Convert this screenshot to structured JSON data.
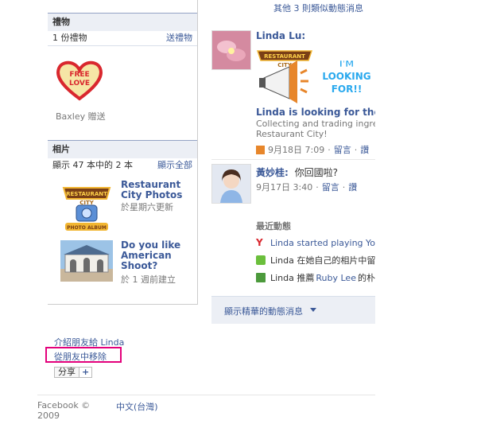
{
  "right_top": {
    "similar_news": "其他 3 則類似動態消息"
  },
  "gifts": {
    "header": "禮物",
    "count": "1 份禮物",
    "send": "送禮物",
    "heart_text": "FREE LOVE",
    "from": "Baxley 贈送"
  },
  "photos": {
    "header": "相片",
    "showing": "顯示 47 本中的 2 本",
    "show_all": "顯示全部",
    "albums": [
      {
        "title": "Restaurant City Photos",
        "meta": "於星期六更新",
        "logo_top": "RESTAURANT",
        "logo_bottom": "CITY",
        "logo_band": "PHOTO ALBUM"
      },
      {
        "title": "Do you like American Shoot?",
        "meta": "於 1 週前建立"
      }
    ]
  },
  "stories": [
    {
      "name": "Linda Lu:",
      "rc_logo_top": "RESTAURANT",
      "rc_logo_bottom": "CITY",
      "promo": "I'M LOOKING FOR!!",
      "headline": "Linda is looking for these",
      "desc1": "Collecting and trading ingredi",
      "desc2": "Restaurant City!",
      "time": "9月18日 7:09",
      "comment": "留言",
      "like": "讚"
    },
    {
      "name": "黃妙桂:",
      "text": "你回國啦?",
      "time": "9月17日 3:40",
      "comment": "留言",
      "like": "讚"
    }
  ],
  "recent": {
    "header": "最近動態",
    "items": [
      {
        "text": "Linda started playing YoV"
      },
      {
        "text": "Linda 在她自己的相片中留"
      },
      {
        "pre": "Linda 推薦 ",
        "link": "Ruby Lee",
        "post": " 的朴"
      }
    ]
  },
  "highlights": {
    "label": "顯示精華的動態消息"
  },
  "profile_actions": {
    "suggest": "介紹朋友給 Linda",
    "remove": "從朋友中移除",
    "share": "分享",
    "plus": "+"
  },
  "footer": {
    "copyright": "Facebook ©",
    "year": "2009",
    "language": "中文(台灣)"
  },
  "colors": {
    "link": "#3b5998",
    "highlight_box": "#e3007b",
    "header_bg": "#eceff5"
  }
}
